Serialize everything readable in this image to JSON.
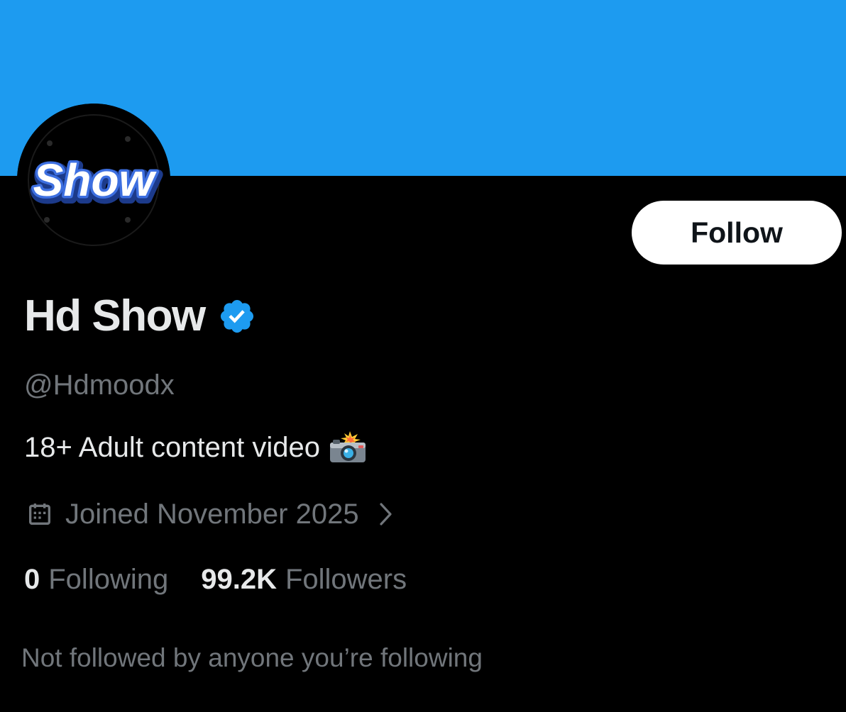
{
  "profile": {
    "display_name": "Hd Show",
    "verified": true,
    "handle": "@Hdmoodx",
    "bio": "18+ Adult content video",
    "bio_emoji": "camera-with-flash-icon",
    "avatar_text": "Show",
    "joined": "Joined November 2025",
    "following_count": "0",
    "following_label": "Following",
    "followers_count": "99.2K",
    "followers_label": "Followers",
    "followers_note": "Not followed by anyone you’re following"
  },
  "actions": {
    "follow_label": "Follow"
  },
  "colors": {
    "banner": "#1d9bf0",
    "background": "#000000",
    "primary_text": "#e7e9ea",
    "secondary_text": "#71767b",
    "verified_badge": "#1d9bf0",
    "button_bg": "#ffffff",
    "button_text": "#0f1419"
  }
}
